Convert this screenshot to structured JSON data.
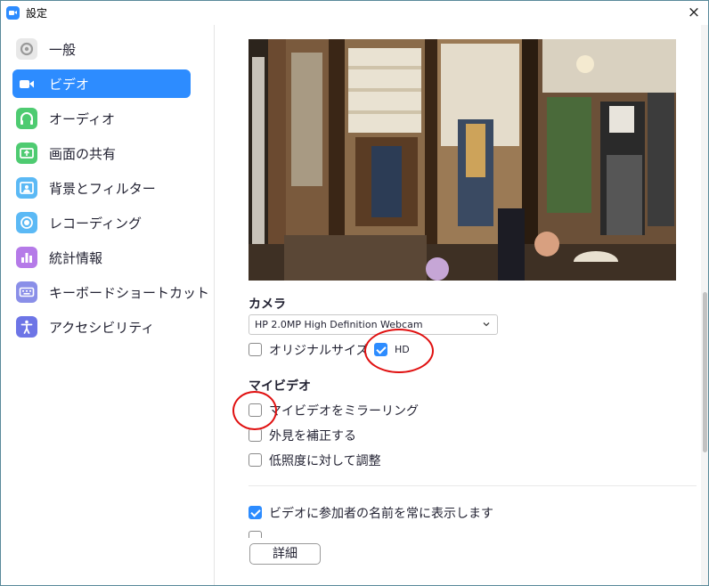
{
  "window": {
    "title": "設定",
    "close_icon": "×"
  },
  "sidebar": {
    "items": [
      {
        "label": "一般",
        "icon": "gear-icon",
        "color": "#e6e6e6",
        "active": false
      },
      {
        "label": "ビデオ",
        "icon": "video-camera-icon",
        "color": "#2D8CFF",
        "active": true
      },
      {
        "label": "オーディオ",
        "icon": "headphones-icon",
        "color": "#4ecb71",
        "active": false
      },
      {
        "label": "画面の共有",
        "icon": "share-screen-icon",
        "color": "#4ecb71",
        "active": false
      },
      {
        "label": "背景とフィルター",
        "icon": "background-icon",
        "color": "#5bb9f5",
        "active": false
      },
      {
        "label": "レコーディング",
        "icon": "recording-icon",
        "color": "#5bb9f5",
        "active": false
      },
      {
        "label": "統計情報",
        "icon": "statistics-icon",
        "color": "#b57ae8",
        "active": false
      },
      {
        "label": "キーボードショートカット",
        "icon": "keyboard-icon",
        "color": "#8a8fe8",
        "active": false
      },
      {
        "label": "アクセシビリティ",
        "icon": "accessibility-icon",
        "color": "#6d75e6",
        "active": false
      }
    ]
  },
  "video": {
    "camera_heading": "カメラ",
    "camera_select": {
      "value": "HP 2.0MP High Definition Webcam"
    },
    "original_size": {
      "label": "オリジナルサイズ",
      "checked": false
    },
    "hd": {
      "label": "HD",
      "checked": true
    },
    "my_video_heading": "マイビデオ",
    "mirror": {
      "label": "マイビデオをミラーリング",
      "checked": false
    },
    "touch_up": {
      "label": "外見を補正する",
      "checked": false
    },
    "low_light": {
      "label": "低照度に対して調整",
      "checked": false
    },
    "show_names": {
      "label": "ビデオに参加者の名前を常に表示します",
      "checked": true
    },
    "details_button": "詳細"
  },
  "colors": {
    "accent": "#2D8CFF",
    "annotation": "#e01010"
  }
}
